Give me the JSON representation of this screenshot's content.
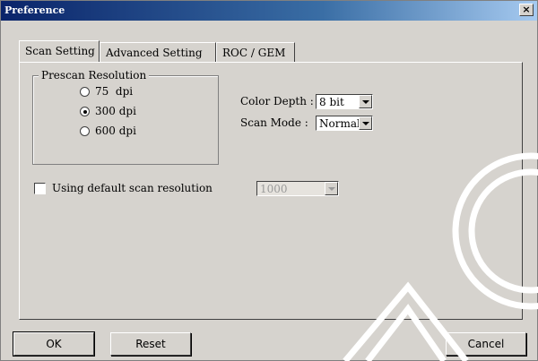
{
  "window": {
    "title": "Preference",
    "close_label": "×"
  },
  "tabs": [
    {
      "label": "Scan Setting",
      "active": true
    },
    {
      "label": "Advanced Setting",
      "active": false
    },
    {
      "label": "ROC / GEM",
      "active": false
    }
  ],
  "prescan": {
    "group_label": "Prescan Resolution",
    "options": [
      {
        "label": "75  dpi",
        "checked": false
      },
      {
        "label": "300 dpi",
        "checked": true
      },
      {
        "label": "600 dpi",
        "checked": false
      }
    ]
  },
  "color_depth": {
    "label": "Color Depth :",
    "value": "8 bit"
  },
  "scan_mode": {
    "label": "Scan Mode :",
    "value": "Normal"
  },
  "default_resolution": {
    "label": "Using default scan resolution",
    "checked": false,
    "value": "1000",
    "enabled": false
  },
  "buttons": {
    "ok": "OK",
    "reset": "Reset",
    "cancel": "Cancel"
  },
  "colors": {
    "face": "#d6d3ce",
    "title_start": "#0a246a",
    "title_end": "#a6caf0"
  }
}
